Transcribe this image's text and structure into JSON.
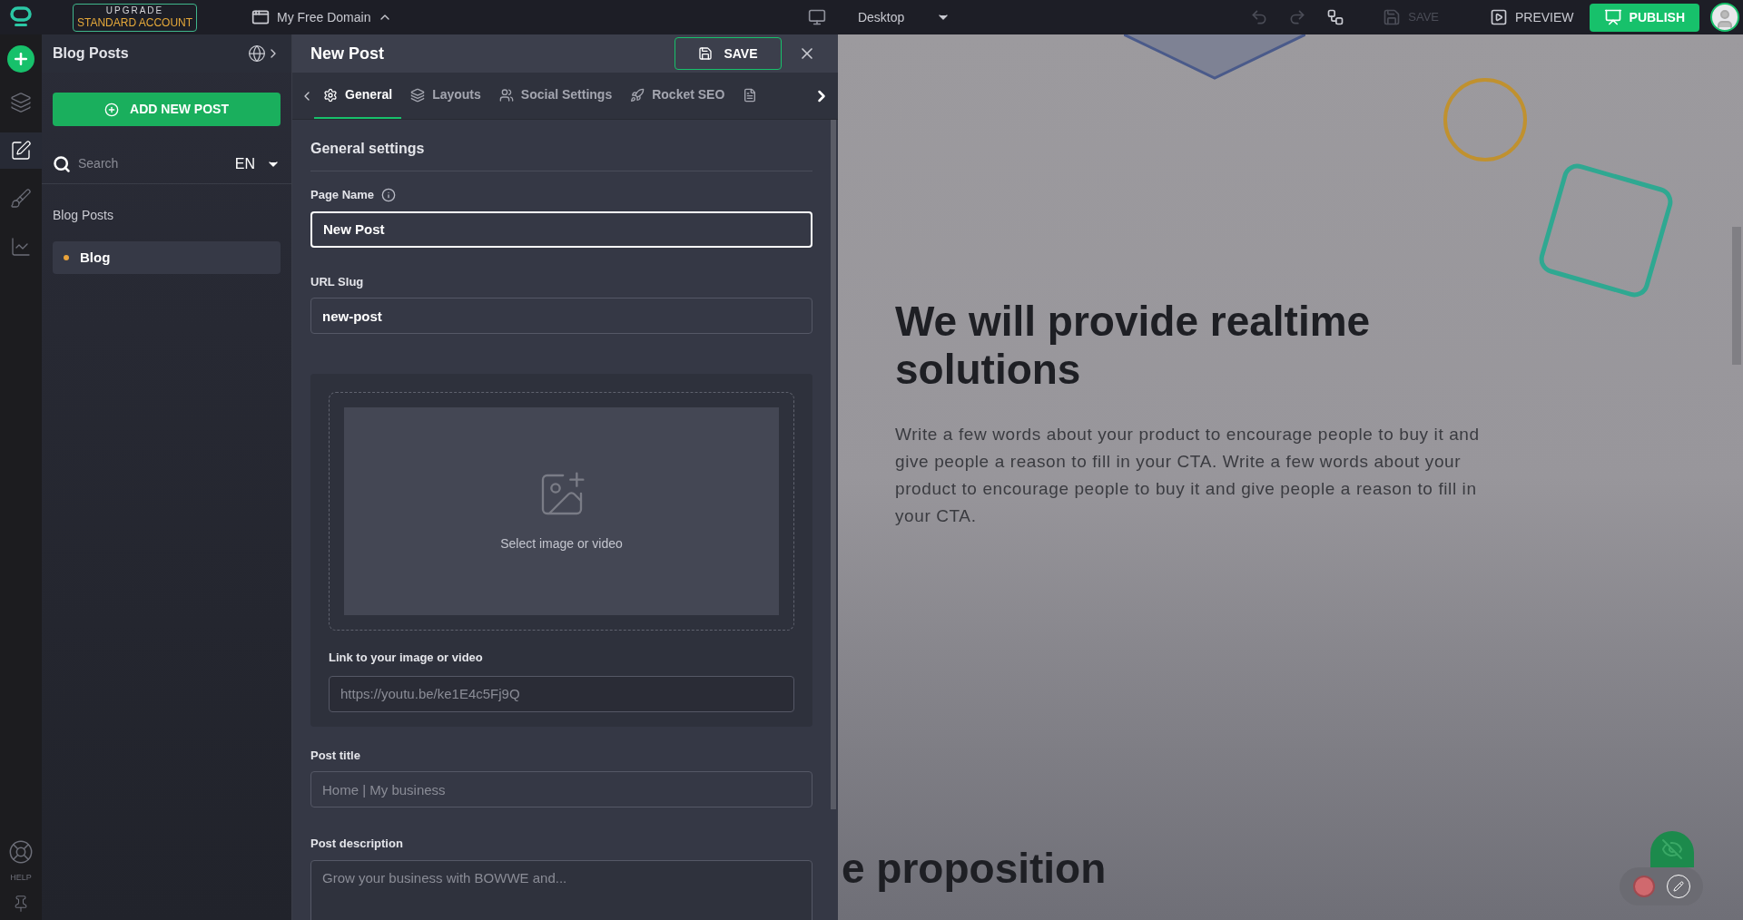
{
  "topbar": {
    "upgrade": {
      "line1": "UPGRADE",
      "line2": "STANDARD ACCOUNT"
    },
    "domain": "My Free Domain",
    "device": "Desktop",
    "save": {
      "label": "SAVE",
      "disabled": true
    },
    "preview": "PREVIEW",
    "publish": "PUBLISH"
  },
  "rail": {
    "items": [
      {
        "kind": "pages",
        "selected": false
      },
      {
        "kind": "edit",
        "selected": true
      },
      {
        "kind": "design",
        "selected": false
      },
      {
        "kind": "stats",
        "selected": false
      }
    ],
    "help": "HELP"
  },
  "sidebar": {
    "title": "Blog Posts",
    "add_button": "ADD NEW POST",
    "search": {
      "placeholder": "Search"
    },
    "language": "EN",
    "section": "Blog Posts",
    "items": [
      {
        "label": "Blog",
        "selected": true,
        "color": "#e9a33b"
      }
    ]
  },
  "editor": {
    "title": "New Post",
    "save": "SAVE",
    "tabs": [
      {
        "kind": "general",
        "label": "General",
        "selected": true
      },
      {
        "kind": "layouts",
        "label": "Layouts",
        "selected": false
      },
      {
        "kind": "social",
        "label": "Social Settings",
        "selected": false
      },
      {
        "kind": "seo",
        "label": "Rocket SEO",
        "selected": false
      },
      {
        "kind": "more",
        "selected": false
      }
    ],
    "section": "General settings",
    "page_name": {
      "label": "Page Name",
      "value": "New Post"
    },
    "url_slug": {
      "label": "URL Slug",
      "value": "new-post"
    },
    "media": {
      "prompt": "Select image or video",
      "link_label": "Link to your image or video",
      "link_placeholder": "https://youtu.be/ke1E4c5Fj9Q"
    },
    "post_title": {
      "label": "Post title",
      "placeholder": "Home | My business"
    },
    "post_description": {
      "label": "Post description",
      "placeholder": "Grow your business with BOWWE and..."
    }
  },
  "preview": {
    "heading": "We will provide realtime solutions",
    "paragraph": "Write a few words about your product to encourage people to buy it and give people a reason to fill in your CTA. Write a few words about your product to encourage people to buy it and give people a reason to fill in your CTA.",
    "next_heading": "e proposition"
  }
}
